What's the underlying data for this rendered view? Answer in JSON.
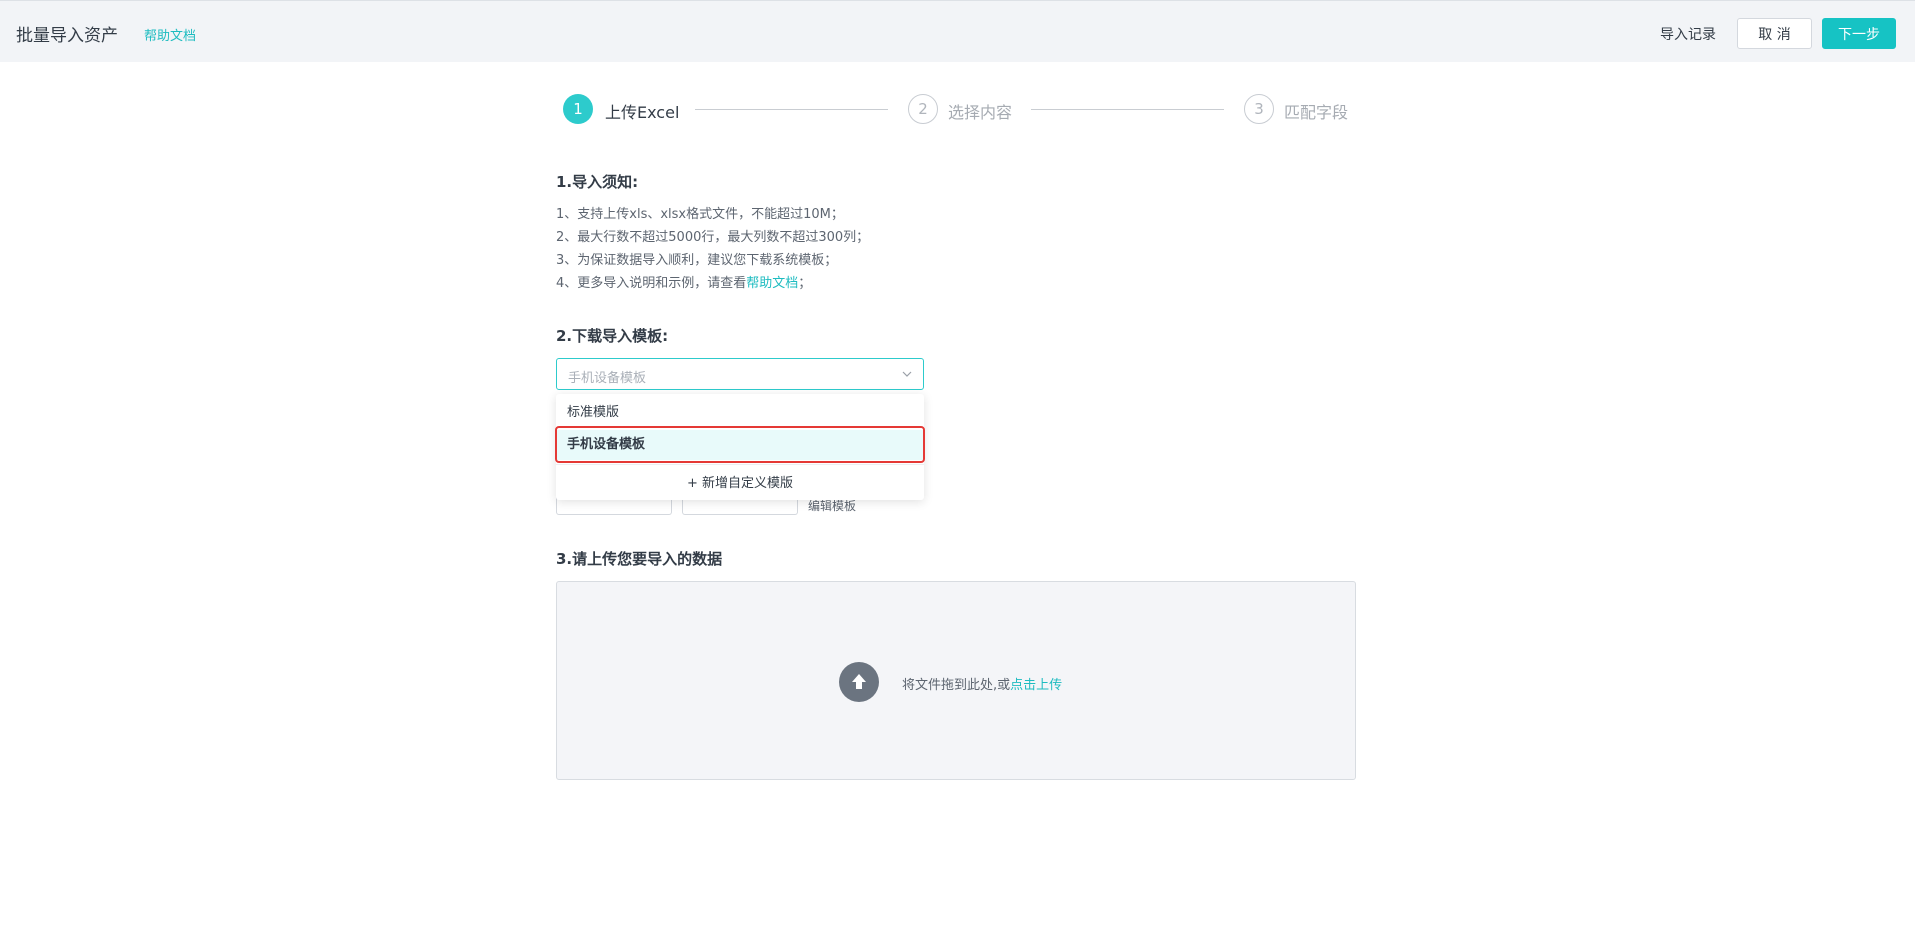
{
  "header": {
    "title": "批量导入资产",
    "help_link": "帮助文档",
    "import_record": "导入记录",
    "cancel": "取 消",
    "next": "下一步"
  },
  "steps": [
    {
      "number": "1",
      "label": "上传Excel",
      "state": "active"
    },
    {
      "number": "2",
      "label": "选择内容",
      "state": "inactive"
    },
    {
      "number": "3",
      "label": "匹配字段",
      "state": "inactive"
    }
  ],
  "notice": {
    "title": "1.导入须知:",
    "lines": [
      "1、支持上传xls、xlsx格式文件，不能超过10M；",
      "2、最大行数不超过5000行，最大列数不超过300列；",
      "3、为保证数据导入顺利，建议您下载系统模板；"
    ],
    "line4_prefix": "4、更多导入说明和示例，请查看",
    "line4_link": "帮助文档",
    "line4_suffix": "；"
  },
  "template": {
    "title": "2.下载导入模板:",
    "select_value": "手机设备模板",
    "options": [
      "标准模版",
      "手机设备模板"
    ],
    "selected_index": 1,
    "add_custom": "+ 新增自定义模版",
    "edit_template": "编辑模板"
  },
  "upload": {
    "title": "3.请上传您要导入的数据",
    "text": "将文件拖到此处,或",
    "link": "点击上传"
  },
  "colors": {
    "accent": "#16c3c4",
    "highlight": "#e53935"
  }
}
